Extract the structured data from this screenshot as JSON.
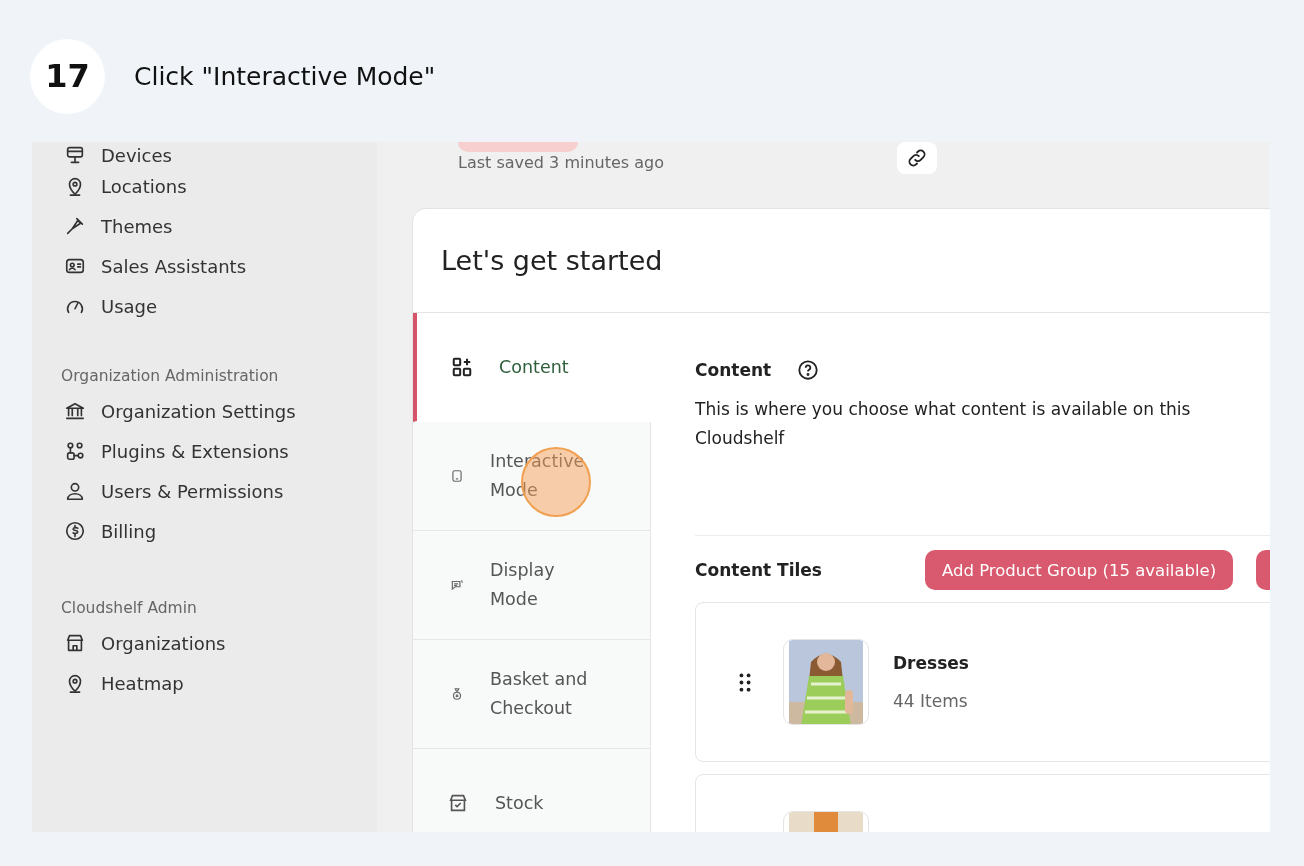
{
  "step": {
    "number": "17",
    "instruction": "Click \"Interactive Mode\""
  },
  "sidebar": {
    "sections": [
      {
        "items": [
          {
            "label": "Devices"
          },
          {
            "label": "Locations"
          },
          {
            "label": "Themes"
          },
          {
            "label": "Sales Assistants"
          },
          {
            "label": "Usage"
          }
        ]
      },
      {
        "title": "Organization Administration",
        "items": [
          {
            "label": "Organization Settings"
          },
          {
            "label": "Plugins & Extensions"
          },
          {
            "label": "Users & Permissions"
          },
          {
            "label": "Billing"
          }
        ]
      },
      {
        "title": "Cloudshelf Admin",
        "items": [
          {
            "label": "Organizations"
          },
          {
            "label": "Heatmap"
          }
        ]
      }
    ]
  },
  "header": {
    "last_saved": "Last saved 3 minutes ago"
  },
  "card": {
    "title": "Let's get started",
    "tabs": [
      {
        "label": "Content",
        "selected": true
      },
      {
        "label": "Interactive Mode",
        "selected": false
      },
      {
        "label": "Display Mode",
        "selected": false
      },
      {
        "label": "Basket and Checkout",
        "selected": false
      },
      {
        "label": "Stock",
        "selected": false
      }
    ],
    "section": {
      "title": "Content",
      "description": "This is where you choose what content is available on this Cloudshelf"
    },
    "tiles_title": "Content Tiles",
    "add_button": "Add Product Group (15 available)",
    "tiles": [
      {
        "name": "Dresses",
        "count": "44 Items"
      }
    ]
  }
}
